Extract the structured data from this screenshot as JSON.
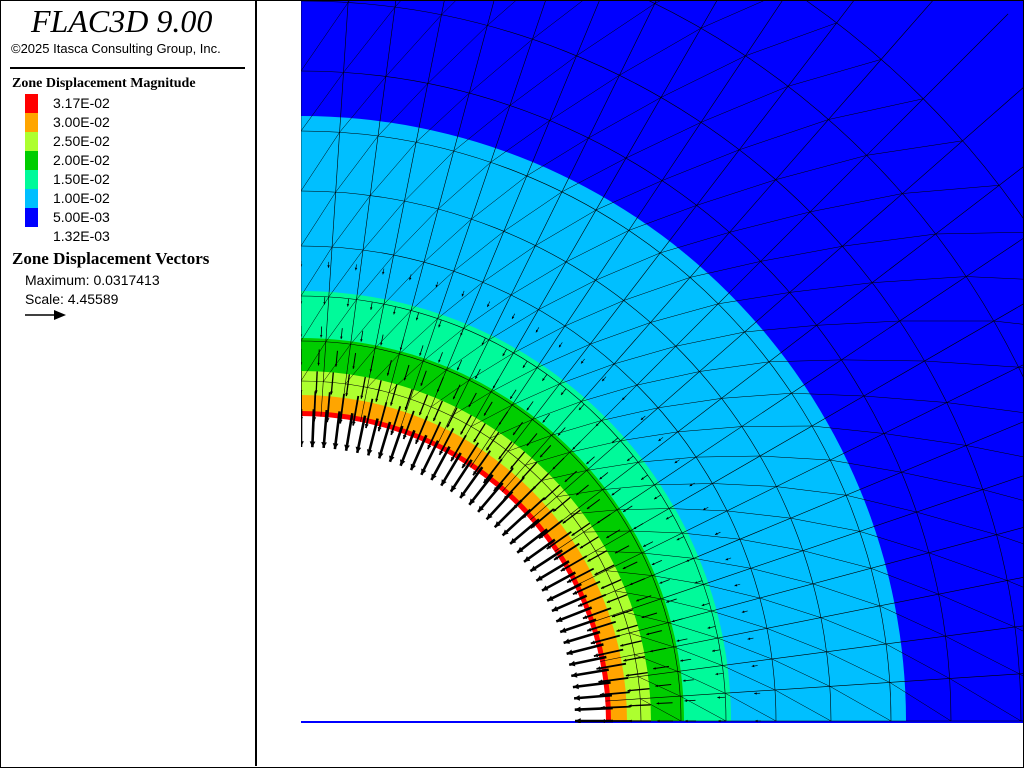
{
  "app": {
    "title": "FLAC3D 9.00",
    "copyright": "©2025 Itasca Consulting Group, Inc."
  },
  "legend": {
    "magnitude_title": "Zone Displacement Magnitude",
    "scale": [
      {
        "value": "3.17E-02",
        "color": "#ff0000"
      },
      {
        "value": "3.00E-02",
        "color": "#ffa500"
      },
      {
        "value": "2.50E-02",
        "color": "#adff2f"
      },
      {
        "value": "2.00E-02",
        "color": "#00cd00"
      },
      {
        "value": "1.50E-02",
        "color": "#00fa9a"
      },
      {
        "value": "1.00E-02",
        "color": "#00bfff"
      },
      {
        "value": "5.00E-03",
        "color": "#0000ff"
      },
      {
        "value": "1.32E-03",
        "color": ""
      }
    ],
    "vectors_title": "Zone Displacement Vectors",
    "vectors_max": "Maximum: 0.0317413",
    "vectors_scale": "Scale: 4.45589",
    "arrow_icon": "right-arrow-icon"
  },
  "plot": {
    "bands": [
      {
        "color": "#0000ff"
      },
      {
        "color": "#00bfff"
      },
      {
        "color": "#00fa9a"
      },
      {
        "color": "#00cd00"
      },
      {
        "color": "#adff2f"
      },
      {
        "color": "#ffa500"
      },
      {
        "color": "#ff0000"
      }
    ],
    "mesh_color": "#000000",
    "vector_color": "#000000"
  }
}
